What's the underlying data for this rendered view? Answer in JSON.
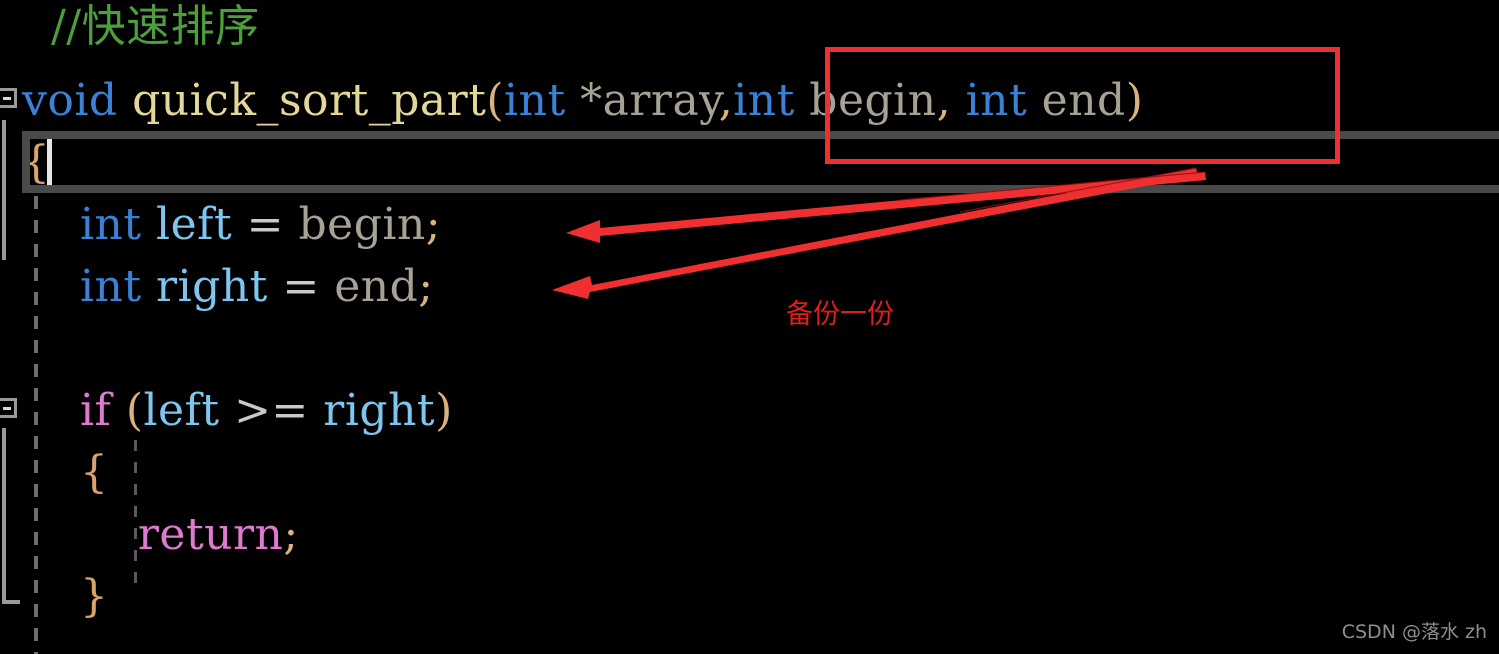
{
  "editor": {
    "background": "#000000",
    "default_text_color": "#c8c8c8",
    "current_line_border_color": "#4a4a4a",
    "gutter_color": "#9a9a9a",
    "indent_guide_color": "#6e6e6e",
    "lines": [
      {
        "id": "line-comment",
        "indent": 1,
        "tokens": [
          {
            "text": "//快速排序",
            "kind": "comment"
          }
        ]
      },
      {
        "id": "line-signature",
        "indent": 0,
        "tokens": [
          {
            "text": "void",
            "kind": "keyword"
          },
          {
            "text": " ",
            "kind": "plain"
          },
          {
            "text": "quick_sort_part",
            "kind": "func"
          },
          {
            "text": "(",
            "kind": "punct"
          },
          {
            "text": "int",
            "kind": "keyword"
          },
          {
            "text": " ",
            "kind": "plain"
          },
          {
            "text": "*array",
            "kind": "var"
          },
          {
            "text": ",",
            "kind": "punct"
          },
          {
            "text": "int",
            "kind": "keyword"
          },
          {
            "text": " ",
            "kind": "plain"
          },
          {
            "text": "begin",
            "kind": "var"
          },
          {
            "text": ",",
            "kind": "punct"
          },
          {
            "text": " ",
            "kind": "plain"
          },
          {
            "text": "int",
            "kind": "keyword"
          },
          {
            "text": " ",
            "kind": "plain"
          },
          {
            "text": "end",
            "kind": "var"
          },
          {
            "text": ")",
            "kind": "punct"
          }
        ]
      },
      {
        "id": "line-open-brace",
        "indent": 0,
        "current": true,
        "tokens": [
          {
            "text": "{",
            "kind": "brace"
          }
        ]
      },
      {
        "id": "line-int-left",
        "indent": 1,
        "tokens": [
          {
            "text": "int",
            "kind": "keyword"
          },
          {
            "text": " ",
            "kind": "plain"
          },
          {
            "text": "left",
            "kind": "ident"
          },
          {
            "text": " ",
            "kind": "plain"
          },
          {
            "text": "=",
            "kind": "op"
          },
          {
            "text": " ",
            "kind": "plain"
          },
          {
            "text": "begin",
            "kind": "var"
          },
          {
            "text": ";",
            "kind": "punct"
          }
        ]
      },
      {
        "id": "line-int-right",
        "indent": 1,
        "tokens": [
          {
            "text": "int",
            "kind": "keyword"
          },
          {
            "text": " ",
            "kind": "plain"
          },
          {
            "text": "right",
            "kind": "ident"
          },
          {
            "text": " ",
            "kind": "plain"
          },
          {
            "text": "=",
            "kind": "op"
          },
          {
            "text": " ",
            "kind": "plain"
          },
          {
            "text": "end",
            "kind": "var"
          },
          {
            "text": ";",
            "kind": "punct"
          }
        ]
      },
      {
        "id": "line-blank",
        "indent": 1,
        "tokens": []
      },
      {
        "id": "line-if",
        "indent": 1,
        "tokens": [
          {
            "text": "if",
            "kind": "ctrl"
          },
          {
            "text": " ",
            "kind": "plain"
          },
          {
            "text": "(",
            "kind": "punct"
          },
          {
            "text": "left",
            "kind": "ident"
          },
          {
            "text": " ",
            "kind": "plain"
          },
          {
            "text": ">=",
            "kind": "op"
          },
          {
            "text": " ",
            "kind": "plain"
          },
          {
            "text": "right",
            "kind": "ident"
          },
          {
            "text": ")",
            "kind": "punct"
          }
        ]
      },
      {
        "id": "line-if-open",
        "indent": 1,
        "tokens": [
          {
            "text": "{",
            "kind": "brace"
          }
        ]
      },
      {
        "id": "line-return",
        "indent": 2,
        "tokens": [
          {
            "text": "return",
            "kind": "ctrl"
          },
          {
            "text": ";",
            "kind": "punct"
          }
        ]
      },
      {
        "id": "line-if-close",
        "indent": 1,
        "tokens": [
          {
            "text": "}",
            "kind": "brace"
          }
        ]
      }
    ],
    "fold_markers": [
      {
        "id": "fold-marker-function",
        "state": "expanded"
      },
      {
        "id": "fold-marker-if",
        "state": "expanded"
      }
    ]
  },
  "annotations": {
    "color": "#f03030",
    "highlight_box": {
      "label": "int begin, int end)",
      "description": "red rectangle around the begin and end parameters"
    },
    "note": {
      "text": "备份一份",
      "color": "#e01d1d"
    },
    "arrows": [
      {
        "id": "arrow-to-int-left",
        "points_to": "int left = begin;"
      },
      {
        "id": "arrow-to-int-right",
        "points_to": "int right = end;"
      }
    ]
  },
  "watermark": {
    "text": "CSDN @落水 zh"
  }
}
